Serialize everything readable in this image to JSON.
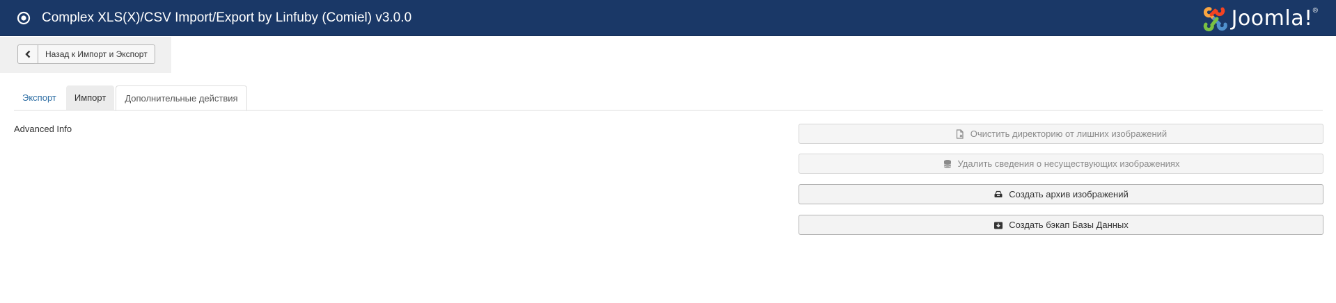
{
  "header": {
    "title": "Complex XLS(X)/CSV Import/Export by Linfuby (Comiel) v3.0.0",
    "icon": "radio-target-icon",
    "logo": {
      "word": "Joomla!",
      "reg": "®"
    },
    "colors": {
      "bar": "#1a3867",
      "text": "#ffffff"
    }
  },
  "toolbar": {
    "back_label": "Назад к Импорт и Экспорт",
    "back_icon": "chevron-left-icon"
  },
  "tabs": [
    {
      "label": "Экспорт",
      "state": "link"
    },
    {
      "label": "Импорт",
      "state": "inactive"
    },
    {
      "label": "Дополнительные действия",
      "state": "active"
    }
  ],
  "main": {
    "section_label": "Advanced Info",
    "actions": [
      {
        "label": "Очистить директорию от лишних изображений",
        "icon": "file-clean-icon",
        "enabled": false
      },
      {
        "label": "Удалить сведения о несуществующих изображениях",
        "icon": "database-icon",
        "enabled": false
      },
      {
        "label": "Создать архив изображений",
        "icon": "archive-icon",
        "enabled": true
      },
      {
        "label": "Создать бэкап Базы Данных",
        "icon": "backup-download-icon",
        "enabled": true
      }
    ]
  }
}
